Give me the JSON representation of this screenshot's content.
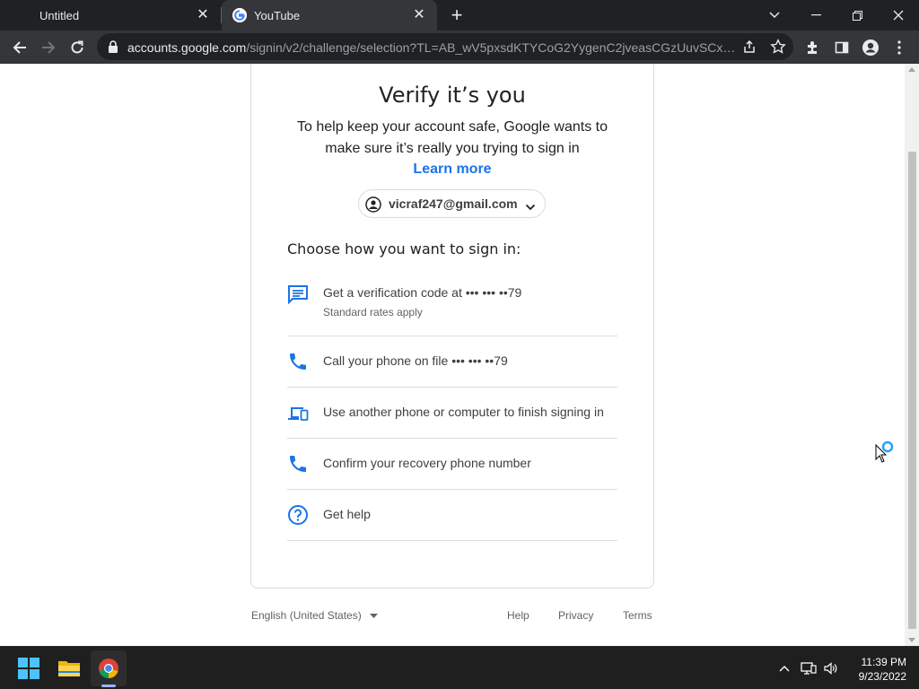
{
  "browser": {
    "tabs": [
      {
        "title": "Untitled",
        "active": false
      },
      {
        "title": "YouTube",
        "active": true
      }
    ],
    "url_host": "accounts.google.com",
    "url_path": "/signin/v2/challenge/selection?TL=AB_wV5pxsdKTYCoG2YygenC2jveasCGzUuvSCxqdF..."
  },
  "signin": {
    "heading": "Verify it’s you",
    "subtext": "To help keep your account safe, Google wants to make sure it’s really you trying to sign in",
    "learn_more": "Learn more",
    "account_email": "vicraf247@gmail.com",
    "choose_label": "Choose how you want to sign in:",
    "options": [
      {
        "icon": "message-icon",
        "label": "Get a verification code at ••• ••• ••79",
        "sub": "Standard rates apply"
      },
      {
        "icon": "phone-icon",
        "label": "Call your phone on file ••• ••• ••79"
      },
      {
        "icon": "devices-icon",
        "label": "Use another phone or computer to finish signing in"
      },
      {
        "icon": "phone-icon",
        "label": "Confirm your recovery phone number"
      },
      {
        "icon": "help-icon",
        "label": "Get help"
      }
    ]
  },
  "footer": {
    "language": "English (United States)",
    "links": [
      "Help",
      "Privacy",
      "Terms"
    ]
  },
  "taskbar": {
    "time": "11:39 PM",
    "date": "9/23/2022"
  },
  "colors": {
    "accent": "#1a73e8",
    "chrome_dark": "#202124",
    "chrome_toolbar": "#35363a"
  }
}
